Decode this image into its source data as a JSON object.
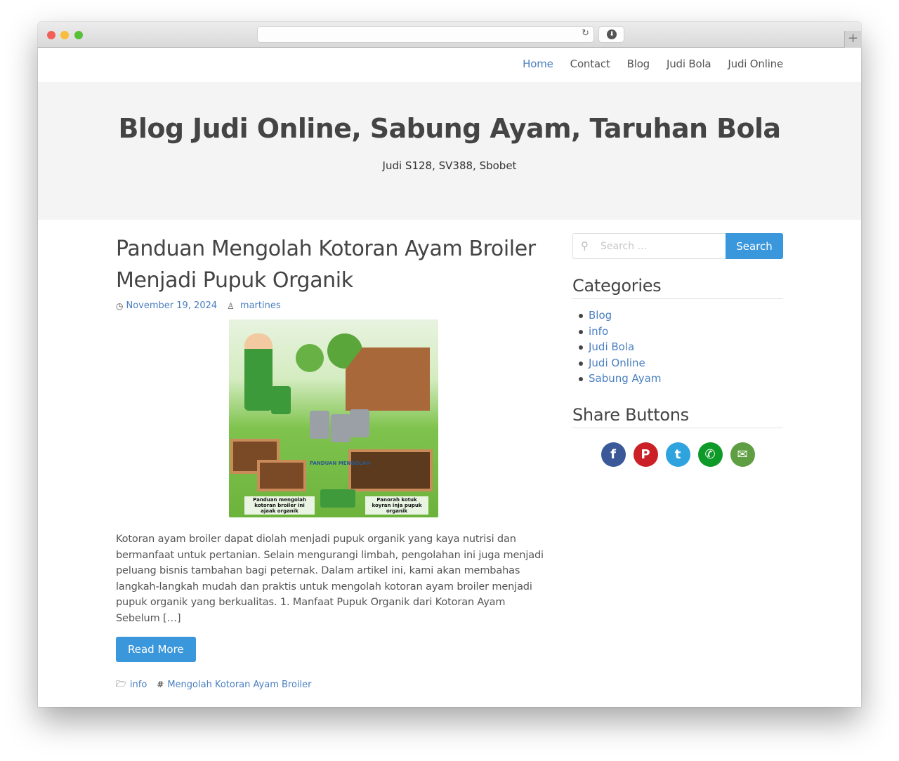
{
  "browser": {
    "reload_icon": "↻",
    "download_icon": "⬇",
    "new_tab_icon": "+"
  },
  "nav": {
    "items": [
      {
        "label": "Home",
        "active": true
      },
      {
        "label": "Contact",
        "active": false
      },
      {
        "label": "Blog",
        "active": false
      },
      {
        "label": "Judi Bola",
        "active": false
      },
      {
        "label": "Judi Online",
        "active": false
      }
    ]
  },
  "hero": {
    "site_title": "Blog Judi Online, Sabung Ayam, Taruhan Bola",
    "tagline": "Judi S128, SV388, Sbobet"
  },
  "post": {
    "title": "Panduan Mengolah Kotoran Ayam Broiler Menjadi Pupuk Organik",
    "date": "November 19, 2024",
    "author": "martines",
    "image": {
      "label_center": "PANDUAN MENGOLAH",
      "caption_left": "Panduan mengolah kotoran broiler ini ajaak organik",
      "caption_right": "Panorah kotuk koyran inja pupuk organik"
    },
    "excerpt": "Kotoran ayam broiler dapat diolah menjadi pupuk organik yang kaya nutrisi dan bermanfaat untuk pertanian. Selain mengurangi limbah, pengolahan ini juga menjadi peluang bisnis tambahan bagi peternak. Dalam artikel ini, kami akan membahas langkah-langkah mudah dan praktis untuk mengolah kotoran ayam broiler menjadi pupuk organik yang berkualitas. 1. Manfaat Pupuk Organik dari Kotoran Ayam Sebelum […]",
    "read_more": "Read More",
    "category": "info",
    "tag": "Mengolah Kotoran Ayam Broiler",
    "icons": {
      "date": "◷",
      "author": "♙",
      "category": "🗁",
      "tag": "#"
    }
  },
  "sidebar": {
    "search": {
      "placeholder": "Search ...",
      "value": "",
      "button": "Search"
    },
    "categories": {
      "title": "Categories",
      "items": [
        "Blog",
        "info",
        "Judi Bola",
        "Judi Online",
        "Sabung Ayam"
      ]
    },
    "share": {
      "title": "Share Buttons",
      "buttons": [
        {
          "name": "facebook",
          "glyph": "f",
          "color": "#3b5998"
        },
        {
          "name": "pinterest",
          "glyph": "P",
          "color": "#cb2027"
        },
        {
          "name": "twitter",
          "glyph": "t",
          "color": "#2ea3dd"
        },
        {
          "name": "whatsapp",
          "glyph": "✆",
          "color": "#0e9a28"
        },
        {
          "name": "email",
          "glyph": "✉",
          "color": "#5f9e43"
        }
      ]
    }
  },
  "colors": {
    "link": "#4a7fc1",
    "button": "#3a97dc",
    "hero_bg": "#f4f4f4"
  }
}
